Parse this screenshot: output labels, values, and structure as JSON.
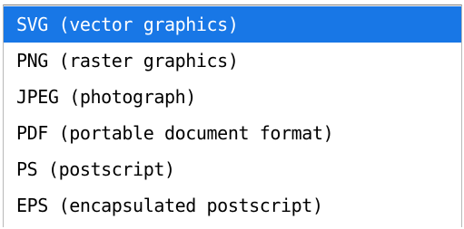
{
  "selection_color": "#1877e6",
  "options": [
    {
      "label": "SVG (vector graphics)",
      "selected": true
    },
    {
      "label": "PNG (raster graphics)",
      "selected": false
    },
    {
      "label": "JPEG (photograph)",
      "selected": false
    },
    {
      "label": "PDF (portable document format)",
      "selected": false
    },
    {
      "label": "PS (postscript)",
      "selected": false
    },
    {
      "label": "EPS (encapsulated postscript)",
      "selected": false
    }
  ]
}
